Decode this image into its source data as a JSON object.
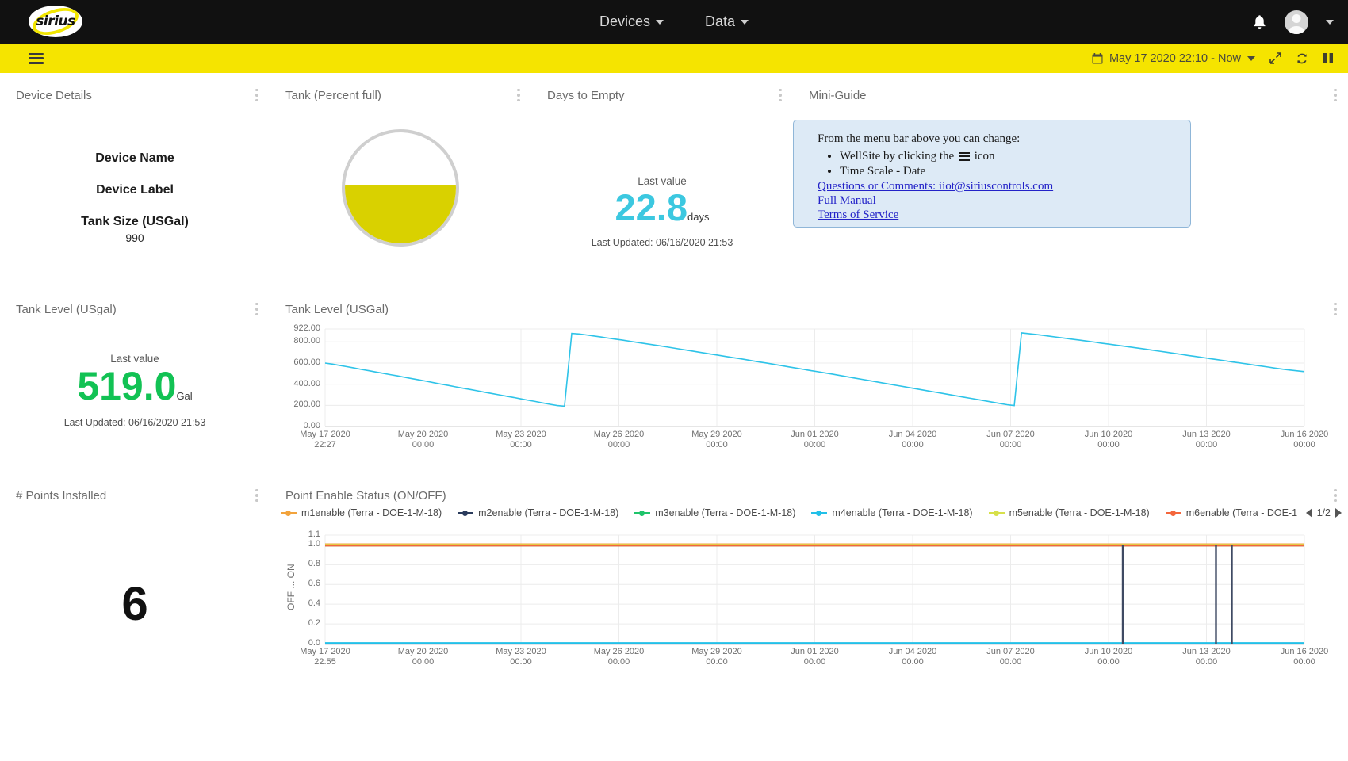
{
  "topbar": {
    "logo_text": "sirius",
    "nav": [
      {
        "label": "Devices",
        "icon": "chevron-down-icon"
      },
      {
        "label": "Data",
        "icon": "chevron-down-icon"
      }
    ],
    "notifications_icon": "bell-icon",
    "avatar_icon": "user-avatar-icon"
  },
  "toolbar": {
    "menu_icon": "hamburger-icon",
    "calendar_icon": "calendar-icon",
    "date_range": "May 17 2020 22:10 - Now",
    "expand_icon": "expand-icon",
    "refresh_icon": "refresh-icon",
    "pause_icon": "pause-icon"
  },
  "device_details": {
    "title": "Device Details",
    "name_label": "Device Name",
    "label_label": "Device Label",
    "tank_size_label": "Tank Size (USGal)",
    "tank_size_value": "990"
  },
  "tank": {
    "title": "Tank (Percent full)",
    "percent_text": "52.4%",
    "percent": 52.4,
    "fill_color": "#d9d100"
  },
  "days_to_empty": {
    "title": "Days to Empty",
    "last_value_label": "Last value",
    "value": "22.8",
    "unit": "days",
    "updated": "Last Updated: 06/16/2020 21:53",
    "color": "#3cc8e0"
  },
  "mini_guide": {
    "title": "Mini-Guide",
    "intro": "From the menu bar above you can change:",
    "bullets": [
      {
        "before": "WellSite by clicking the ",
        "icon": "hamburger-icon",
        "after": " icon"
      },
      {
        "before": "Time Scale - Date",
        "icon": "",
        "after": ""
      }
    ],
    "links": [
      "Questions or Comments: iiot@siriuscontrols.com",
      "Full Manual",
      "Terms of Service"
    ]
  },
  "tank_level_value": {
    "title": "Tank Level (USgal)",
    "last_value_label": "Last value",
    "value": "519.0",
    "unit": "Gal",
    "updated": "Last Updated: 06/16/2020 21:53",
    "color": "#12c254"
  },
  "points_installed": {
    "title": "# Points Installed",
    "value": "6"
  },
  "chart_data": [
    {
      "type": "line",
      "title": "Tank Level (USGal)",
      "xlabel": "",
      "ylabel": "",
      "ylim": [
        0,
        922
      ],
      "yticks": [
        "0.00",
        "200.00",
        "400.00",
        "600.00",
        "800.00",
        "922.00"
      ],
      "xticks": [
        "May 17 2020\n22:27",
        "May 20 2020\n00:00",
        "May 23 2020\n00:00",
        "May 26 2020\n00:00",
        "May 29 2020\n00:00",
        "Jun 01 2020\n00:00",
        "Jun 04 2020\n00:00",
        "Jun 07 2020\n00:00",
        "Jun 10 2020\n00:00",
        "Jun 13 2020\n00:00",
        "Jun 16 2020\n00:00"
      ],
      "grid": true,
      "legend": "none",
      "series": [
        {
          "name": "Tank Level",
          "color": "#2ec3e8",
          "values": [
            600,
            590,
            578,
            566,
            553,
            540,
            528,
            515,
            503,
            490,
            478,
            465,
            452,
            440,
            427,
            414,
            400,
            388,
            375,
            362,
            350,
            337,
            324,
            312,
            299,
            286,
            274,
            261,
            248,
            236,
            223,
            210,
            198,
            192,
            880,
            875,
            866,
            856,
            846,
            836,
            826,
            816,
            806,
            795,
            785,
            774,
            764,
            753,
            742,
            731,
            720,
            709,
            698,
            687,
            676,
            665,
            654,
            643,
            632,
            620,
            609,
            598,
            586,
            575,
            563,
            552,
            540,
            528,
            517,
            505,
            494,
            482,
            470,
            458,
            446,
            434,
            422,
            410,
            398,
            386,
            374,
            362,
            350,
            338,
            326,
            314,
            302,
            290,
            278,
            266,
            254,
            242,
            230,
            218,
            206,
            198,
            885,
            878,
            870,
            861,
            852,
            843,
            834,
            825,
            816,
            807,
            798,
            788,
            779,
            770,
            760,
            751,
            741,
            732,
            722,
            712,
            702,
            692,
            682,
            672,
            662,
            652,
            642,
            632,
            622,
            612,
            602,
            592,
            582,
            572,
            562,
            552,
            542,
            534,
            526,
            519
          ]
        }
      ]
    },
    {
      "type": "line",
      "title": "Point Enable Status (ON/OFF)",
      "xlabel": "",
      "ylabel": "OFF  ...  ON",
      "ylim": [
        0,
        1.1
      ],
      "yticks": [
        "0.0",
        "0.2",
        "0.4",
        "0.6",
        "0.8",
        "1.0",
        "1.1"
      ],
      "xticks": [
        "May 17 2020\n22:55",
        "May 20 2020\n00:00",
        "May 23 2020\n00:00",
        "May 26 2020\n00:00",
        "May 29 2020\n00:00",
        "Jun 01 2020\n00:00",
        "Jun 04 2020\n00:00",
        "Jun 07 2020\n00:00",
        "Jun 10 2020\n00:00",
        "Jun 13 2020\n00:00",
        "Jun 16 2020\n00:00"
      ],
      "grid": true,
      "legend": "top",
      "pager": "1/2",
      "series": [
        {
          "name": "m1enable  (Terra - DOE-1-M-18)",
          "color": "#f2a33c",
          "level": 1.0
        },
        {
          "name": "m2enable  (Terra - DOE-1-M-18)",
          "color": "#2a3b5c",
          "level": 0.0
        },
        {
          "name": "m3enable  (Terra - DOE-1-M-18)",
          "color": "#1fc46b",
          "level": 1.0
        },
        {
          "name": "m4enable  (Terra - DOE-1-M-18)",
          "color": "#22c0e8",
          "level": 0.0
        },
        {
          "name": "m5enable  (Terra - DOE-1-M-18)",
          "color": "#d7e04a",
          "level": 1.0
        },
        {
          "name": "m6enable  (Terra - DOE-1",
          "color": "#f4663c",
          "level": 1.0
        }
      ],
      "dropouts": [
        "Jun 10 2020",
        "Jun 13 2020",
        "Jun 13 2020"
      ]
    }
  ]
}
